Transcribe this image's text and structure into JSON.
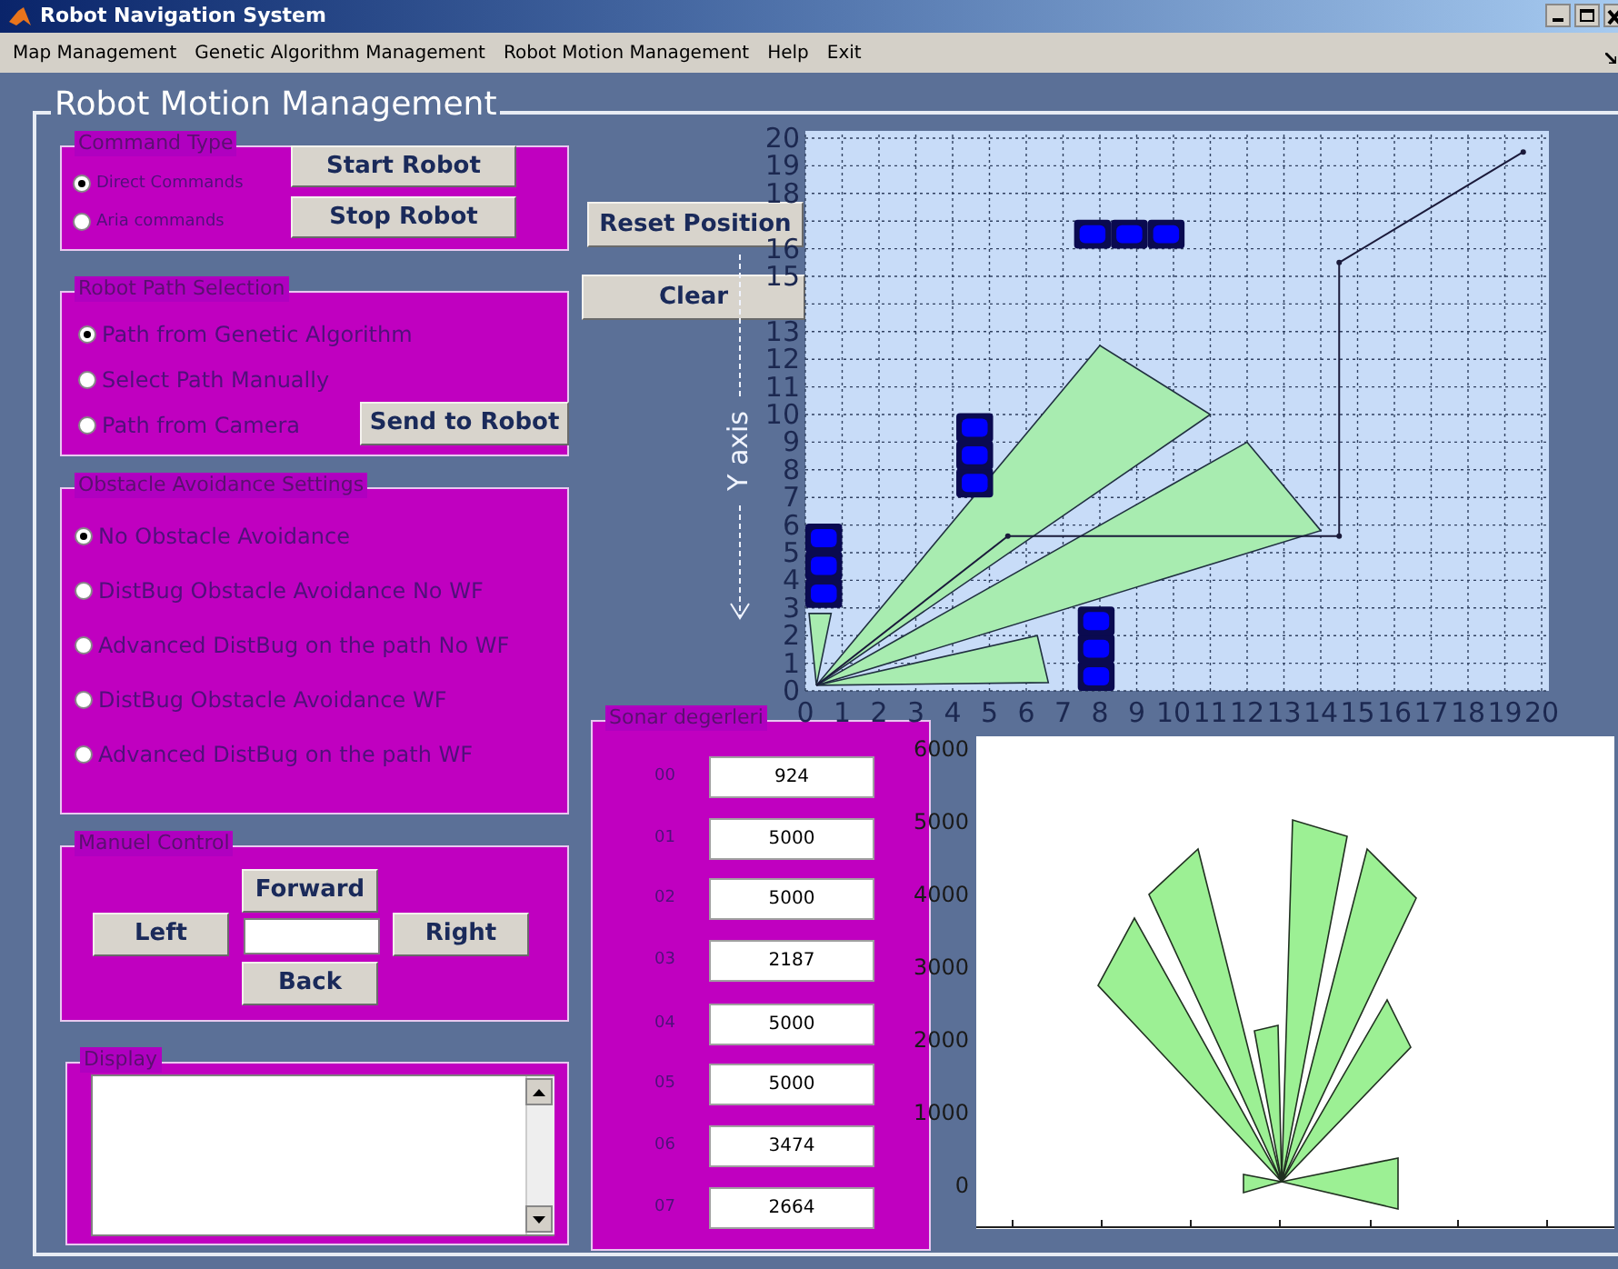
{
  "window": {
    "title": "Robot Navigation System"
  },
  "menu": [
    {
      "label": "Map Management"
    },
    {
      "label": "Genetic Algorithm Management"
    },
    {
      "label": "Robot Motion Management"
    },
    {
      "label": "Help"
    },
    {
      "label": "Exit"
    }
  ],
  "frame": {
    "title": "Robot Motion Management"
  },
  "command_type": {
    "title": "Command Type",
    "options": [
      {
        "label": "Direct Commands",
        "selected": true
      },
      {
        "label": "Aria commands",
        "selected": false
      }
    ],
    "start_button": "Start Robot",
    "stop_button": "Stop Robot"
  },
  "reset_button": "Reset Position",
  "clear_button": "Clear",
  "path_selection": {
    "title": "Robot Path Selection",
    "options": [
      {
        "label": "Path from Genetic Algorithm",
        "selected": true
      },
      {
        "label": "Select Path Manually",
        "selected": false
      },
      {
        "label": "Path from Camera",
        "selected": false
      }
    ],
    "send_button": "Send to Robot"
  },
  "obstacle_avoidance": {
    "title": "Obstacle Avoidance Settings",
    "options": [
      {
        "label": "No Obstacle Avoidance",
        "selected": true
      },
      {
        "label": "DistBug Obstacle Avoidance No WF",
        "selected": false
      },
      {
        "label": "Advanced DistBug on the path No WF",
        "selected": false
      },
      {
        "label": "DistBug Obstacle Avoidance WF",
        "selected": false
      },
      {
        "label": "Advanced DistBug on the path WF",
        "selected": false
      }
    ]
  },
  "manual_control": {
    "title": "Manuel Control",
    "forward": "Forward",
    "left": "Left",
    "right": "Right",
    "back": "Back"
  },
  "display": {
    "title": "Display"
  },
  "map_plot": {
    "chart_data": {
      "type": "line",
      "ylabel": "Y axis",
      "x": [
        0.3,
        5.5,
        14.5,
        14.5,
        19.5
      ],
      "series": [
        {
          "color": "#1a1a3a",
          "marker": "o",
          "values": [
            0.2,
            5.6,
            5.6,
            15.5,
            19.5
          ]
        }
      ],
      "grid": true,
      "xlim": [
        0,
        20
      ],
      "ylim": [
        0,
        20
      ],
      "xticks": [
        0,
        1,
        2,
        3,
        4,
        5,
        6,
        7,
        8,
        9,
        10,
        11,
        12,
        13,
        14,
        15,
        16,
        17,
        18,
        19,
        20
      ],
      "yticks": [
        0,
        1,
        2,
        3,
        4,
        5,
        6,
        7,
        8,
        9,
        10,
        11,
        12,
        13,
        15,
        16,
        18,
        19,
        20
      ]
    }
  },
  "sonar": {
    "title": "Sonar degerleri",
    "readings": [
      {
        "label": "00",
        "value": "924"
      },
      {
        "label": "01",
        "value": "5000"
      },
      {
        "label": "02",
        "value": "5000"
      },
      {
        "label": "03",
        "value": "2187"
      },
      {
        "label": "04",
        "value": "5000"
      },
      {
        "label": "05",
        "value": "5000"
      },
      {
        "label": "06",
        "value": "3474"
      },
      {
        "label": "07",
        "value": "2664"
      }
    ]
  },
  "sonar_plot": {
    "y_ticks": [
      "6000",
      "5000",
      "4000",
      "3000",
      "2000",
      "1000",
      "0"
    ]
  }
}
